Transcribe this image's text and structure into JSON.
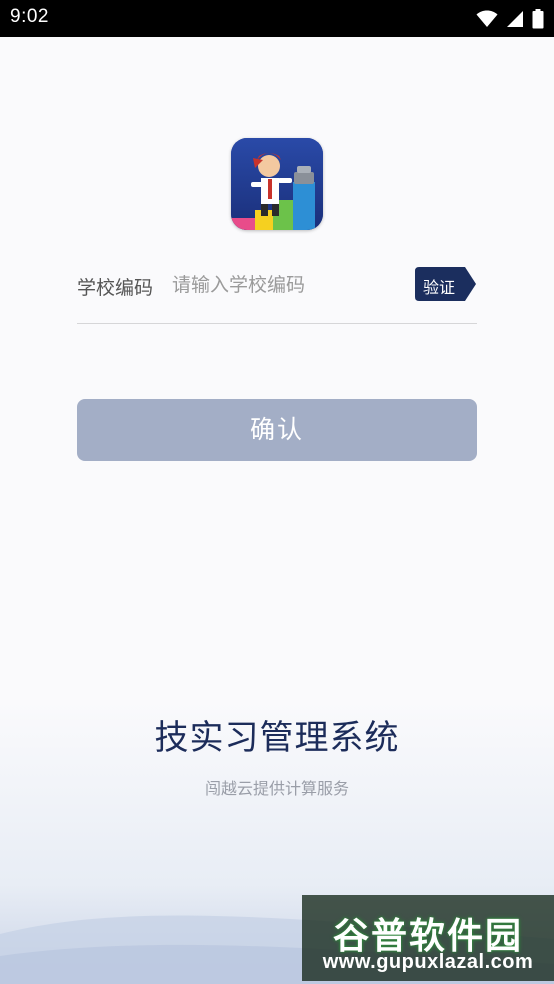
{
  "status_bar": {
    "time": "9:02"
  },
  "icons": {
    "wifi": "wifi-icon",
    "signal": "signal-icon",
    "battery": "battery-icon"
  },
  "school_code": {
    "label": "学校编码",
    "placeholder": "请输入学校编码",
    "value": "",
    "verify_label": "验证"
  },
  "confirm_label": "确认",
  "app_title": "技实习管理系统",
  "provider_text": "闯越云提供计算服务",
  "watermark": {
    "logo_text": "谷普软件园",
    "url": "www.gupuxlazal.com"
  },
  "colors": {
    "accent_dark": "#1c2c5a",
    "confirm_disabled": "#a3aec6",
    "verify_bg": "#1b2e5e"
  }
}
